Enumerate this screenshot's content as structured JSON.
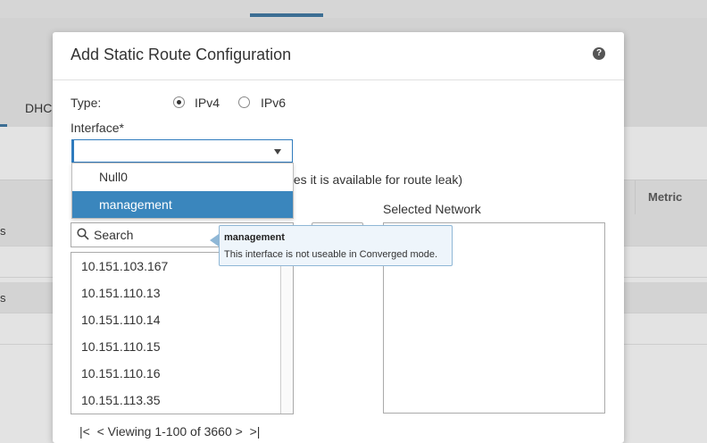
{
  "background": {
    "tab_label": "DHC",
    "table_header": {
      "metric": "Metric"
    },
    "row_fragments": [
      "s",
      "s"
    ]
  },
  "modal": {
    "title": "Add Static Route Configuration",
    "help_icon": "question-circle-icon",
    "type_label": "Type:",
    "type_options": [
      "IPv4",
      "IPv6"
    ],
    "type_selected": "IPv4",
    "interface_label": "Interface*",
    "interface_value": "",
    "interface_options": [
      {
        "label": "Null0",
        "selected": false
      },
      {
        "label": "management",
        "selected": true
      }
    ],
    "route_leak_text": "nifies it is available for route leak)",
    "search_placeholder": "Search",
    "available_networks": [
      "10.151.103.167",
      "10.151.110.13",
      "10.151.110.14",
      "10.151.110.15",
      "10.151.110.16",
      "10.151.113.35"
    ],
    "selected_network_title": "Selected Network",
    "pager": {
      "first": "|<",
      "prev": "<",
      "text": "Viewing 1-100 of 3660",
      "next": ">",
      "last": ">|"
    }
  },
  "tooltip": {
    "title": "management",
    "message": "This interface is not useable in Converged mode."
  },
  "colors": {
    "accent": "#3a86bd",
    "tooltip_bg": "#eef5fb"
  }
}
